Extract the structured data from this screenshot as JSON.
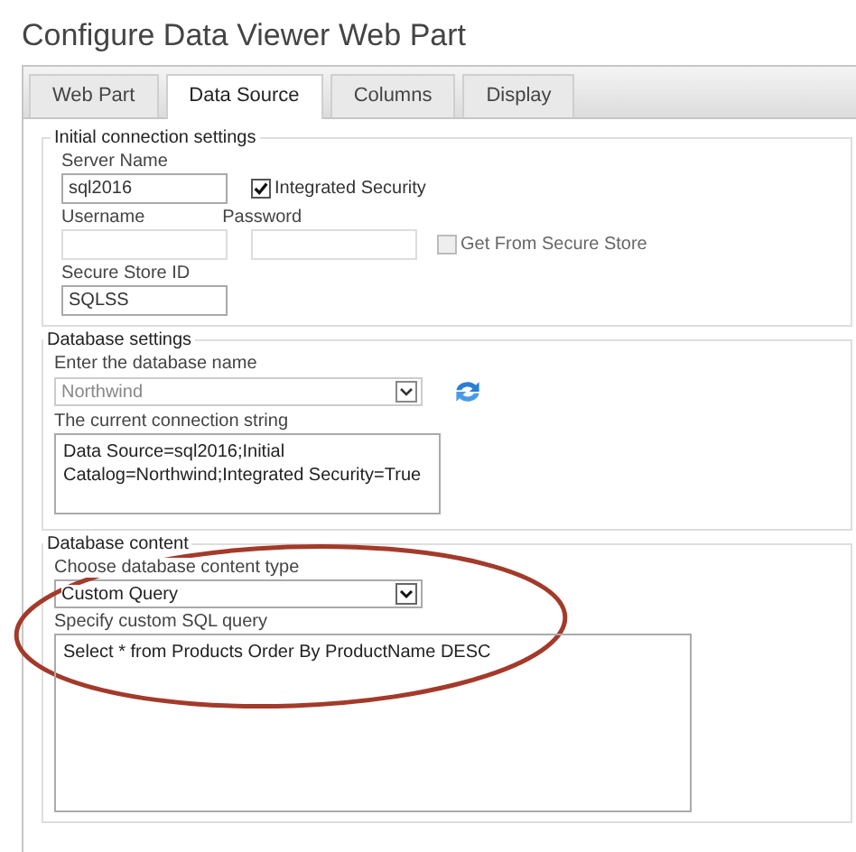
{
  "title": "Configure Data Viewer Web Part",
  "tabs": [
    {
      "label": "Web Part",
      "selected": false
    },
    {
      "label": "Data Source",
      "selected": true
    },
    {
      "label": "Columns",
      "selected": false
    },
    {
      "label": "Display",
      "selected": false
    }
  ],
  "connection": {
    "legend": "Initial connection settings",
    "server_label": "Server Name",
    "server_value": "sql2016",
    "integrated": {
      "label": "Integrated Security",
      "checked": true
    },
    "username_label": "Username",
    "password_label": "Password",
    "secure_store": {
      "label": "Get From Secure Store",
      "checked": false,
      "disabled": true
    },
    "store_id_label": "Secure Store ID",
    "store_id_value": "SQLSS"
  },
  "database": {
    "legend": "Database settings",
    "name_label": "Enter the database name",
    "name_value": "Northwind",
    "name_disabled": true,
    "string_label": "The current connection string",
    "string_value": "Data Source=sql2016;Initial Catalog=Northwind;Integrated Security=True"
  },
  "content": {
    "legend": "Database content",
    "type_label": "Choose database content type",
    "type_value": "Custom Query",
    "query_label": "Specify custom SQL query",
    "query_value": "Select * from Products Order By ProductName DESC"
  }
}
